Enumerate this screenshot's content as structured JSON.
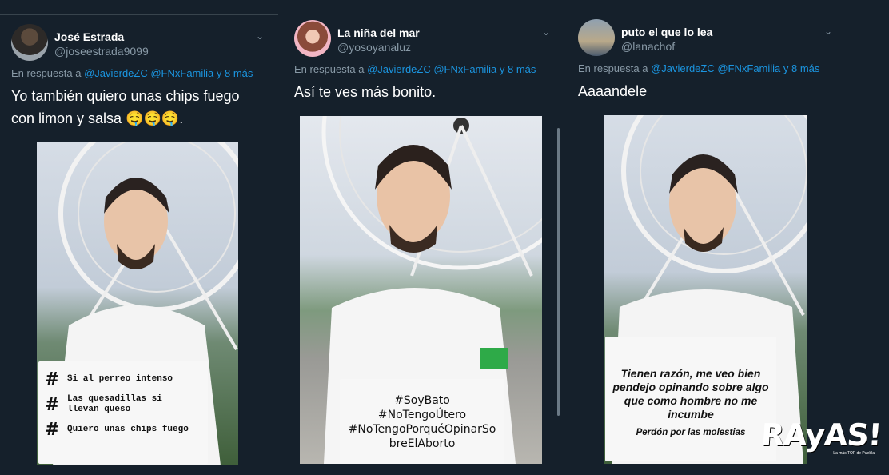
{
  "tweets": [
    {
      "name": "José Estrada",
      "handle": "@joseestrada9099",
      "reply_prefix": "En respuesta a",
      "reply_to": "@JavierdeZC @FNxFamilia y 8 más",
      "text": "Yo también quiero unas chips fuego con limon y salsa 🤤🤤🤤.",
      "sign_items": [
        "Si al perreo intenso",
        "Las quesadillas si llevan queso",
        "Quiero unas chips fuego"
      ]
    },
    {
      "name": "La niña del mar",
      "handle": "@yosoyanaluz",
      "reply_prefix": "En respuesta a",
      "reply_to": "@JavierdeZC @FNxFamilia y 8 más",
      "text": "Así te ves más bonito.",
      "sign_lines": [
        "#SoyBato",
        "#NoTengoÚtero",
        "#NoTengoPorquéOpinarSo",
        "breElAborto"
      ]
    },
    {
      "name": "puto el que lo lea",
      "handle": "@lanachof",
      "reply_prefix": "En respuesta a",
      "reply_to": "@JavierdeZC @FNxFamilia y 8 más",
      "text": "Aaaandele",
      "sign_main": "Tienen razón, me veo bien pendejo opinando sobre algo que como hombre no me incumbe",
      "sign_small": "Perdón por las molestias"
    }
  ],
  "watermark": {
    "logo": "RAyAS!",
    "sub": "La más TOP de Puebla"
  },
  "colors": {
    "background": "#15202b",
    "link": "#1b95e0",
    "muted": "#8899a6"
  },
  "icons": {
    "caret": "chevron-down-icon",
    "sign_hash": "hashtag-icon"
  }
}
